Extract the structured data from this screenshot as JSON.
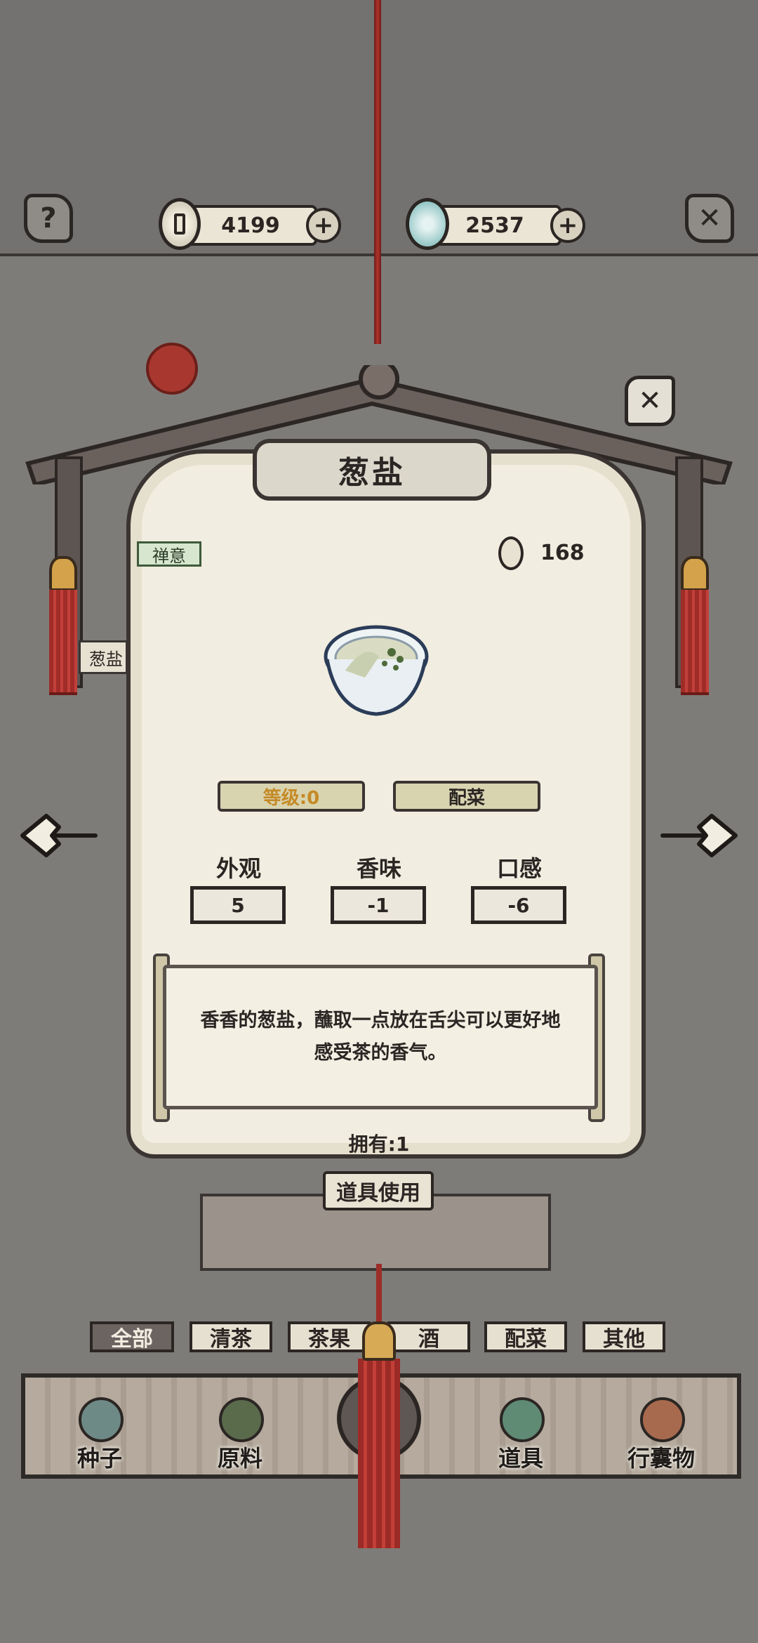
{
  "hud": {
    "help_icon": "?",
    "copper_value": "4199",
    "jade_value": "2537",
    "plus_symbol": "+",
    "close_symbol": "✕"
  },
  "item": {
    "name": "葱盐",
    "tag": "禅意",
    "price": "168",
    "level_label": "等级:0",
    "category_label": "配菜",
    "stats": [
      {
        "label": "外观",
        "value": "5"
      },
      {
        "label": "香味",
        "value": "-1"
      },
      {
        "label": "口感",
        "value": "-6"
      }
    ],
    "description": "香香的葱盐，蘸取一点放在舌尖可以更好地感受茶的香气。",
    "owned": "拥有:1",
    "use_button": "道具使用",
    "side_tab": "葱盐"
  },
  "filters": [
    {
      "label": "全部",
      "active": true
    },
    {
      "label": "清茶",
      "active": false
    },
    {
      "label": "茶果",
      "active": false
    },
    {
      "label": "酒",
      "active": false
    },
    {
      "label": "配菜",
      "active": false
    },
    {
      "label": "其他",
      "active": false
    }
  ],
  "nav": [
    {
      "label": "种子",
      "icon": "seed-jar-icon"
    },
    {
      "label": "原料",
      "icon": "tea-leaf-icon"
    },
    {
      "label": "道具",
      "icon": "tray-icon"
    },
    {
      "label": "行囊物",
      "icon": "robe-icon"
    }
  ],
  "colors": {
    "background": "#7e7c79",
    "panel": "#f1ede0",
    "level_gold": "#c58a26",
    "tassel_red": "#a02c28",
    "tag_green": "#d7e6cf"
  }
}
